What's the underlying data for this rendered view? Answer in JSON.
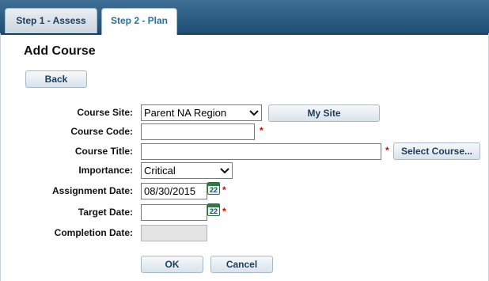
{
  "tabs": [
    {
      "label": "Step 1 - Assess",
      "active": false
    },
    {
      "label": "Step 2 - Plan",
      "active": true
    }
  ],
  "page_title": "Add Course",
  "back_label": "Back",
  "form": {
    "course_site": {
      "label": "Course Site:",
      "value": "Parent NA Region",
      "my_site_label": "My Site"
    },
    "course_code": {
      "label": "Course Code:",
      "value": "",
      "required_mark": "*"
    },
    "course_title": {
      "label": "Course Title:",
      "value": "",
      "required_mark": "*",
      "select_label": "Select Course..."
    },
    "importance": {
      "label": "Importance:",
      "value": "Critical"
    },
    "assignment_date": {
      "label": "Assignment Date:",
      "value": "08/30/2015",
      "required_mark": "*",
      "calendar_day": "22"
    },
    "target_date": {
      "label": "Target Date:",
      "value": "",
      "required_mark": "*",
      "calendar_day": "22"
    },
    "completion_date": {
      "label": "Completion Date:",
      "value": ""
    }
  },
  "actions": {
    "ok_label": "OK",
    "cancel_label": "Cancel"
  },
  "icons": {
    "calendar": "calendar-icon",
    "dropdown": "chevron-down-icon"
  },
  "colors": {
    "tabbar": "#2b5a80",
    "required": "#d40000"
  }
}
